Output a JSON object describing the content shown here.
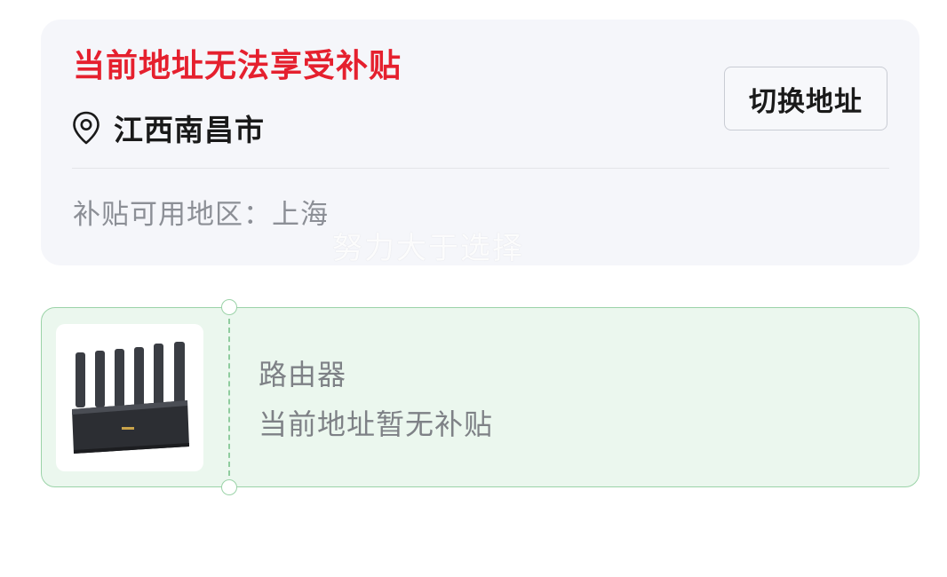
{
  "address_card": {
    "warning_title": "当前地址无法享受补贴",
    "location": "江西南昌市",
    "location_icon": "location-pin-icon",
    "switch_button_label": "切换地址",
    "available_region_label": "补贴可用地区：",
    "available_region_value": "上海",
    "watermark": "努力大于选择"
  },
  "coupon_card": {
    "product_name": "路由器",
    "status": "当前地址暂无补贴",
    "product_image": "router-product-image",
    "accent_color": "#ebf7ee",
    "border_color": "#9bd3a8"
  },
  "colors": {
    "warning": "#e5202e",
    "muted_text": "#8c8f96",
    "card_bg": "#f5f6fa"
  }
}
